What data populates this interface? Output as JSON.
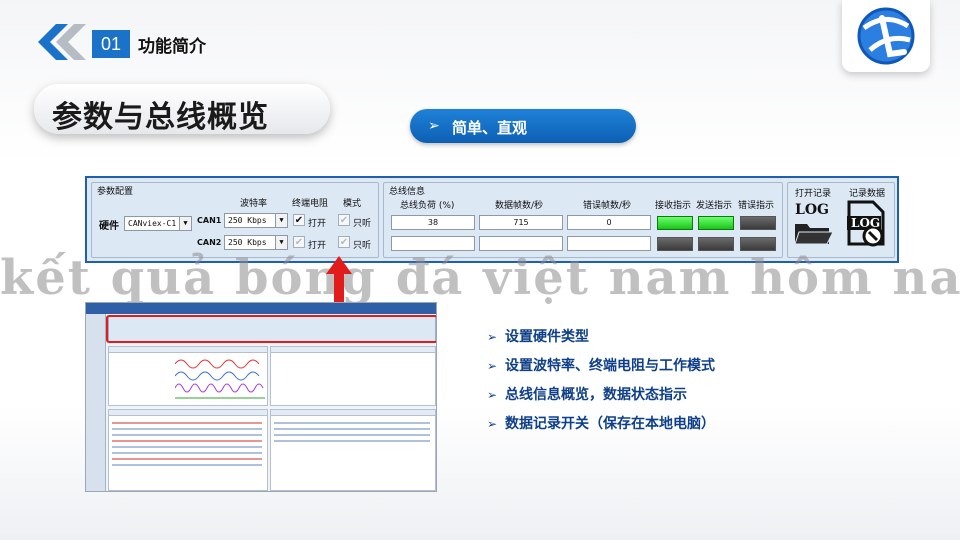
{
  "header": {
    "section_number": "01",
    "section_title": "功能简介",
    "main_title": "参数与总线概览",
    "subtitle_arrow": "➢",
    "subtitle": "简单、直观"
  },
  "config_panel": {
    "param_group_title": "参数配置",
    "col_baud": "波特率",
    "col_term": "终端电阻",
    "col_mode": "模式",
    "hardware_label": "硬件",
    "hardware_value": "CANviex-C1",
    "channels": [
      {
        "name": "CAN1",
        "baud": "250 Kbps",
        "term_label": "打开",
        "mode_label": "只听"
      },
      {
        "name": "CAN2",
        "baud": "250 Kbps",
        "term_label": "打开",
        "mode_label": "只听"
      }
    ],
    "bus_group_title": "总线信息",
    "col_load": "总线负荷 (%)",
    "col_fps": "数据帧数/秒",
    "col_err": "错误帧数/秒",
    "col_rx": "接收指示",
    "col_tx": "发送指示",
    "col_errind": "错误指示",
    "bus_rows": [
      {
        "load": "38",
        "fps": "715",
        "err": "0"
      },
      {
        "load": "",
        "fps": "",
        "err": ""
      }
    ],
    "open_record_label": "打开记录",
    "record_data_label": "记录数据",
    "log_text": "LOG"
  },
  "watermark": "kết quả bóng đá việt nam hôm nay",
  "bullets": [
    {
      "arrow": "➢",
      "text": "设置硬件类型"
    },
    {
      "arrow": "➢",
      "text": "设置波特率、终端电阻与工作模式"
    },
    {
      "arrow": "➢",
      "text": "总线信息概览，数据状态指示"
    },
    {
      "arrow": "➢",
      "text": "数据记录开关（保存在本地电脑）"
    }
  ],
  "colors": {
    "accent_blue": "#1a72c9",
    "panel_border": "#1f5fb0",
    "led_on": "#19c419",
    "highlight_red": "#e21b1b"
  }
}
